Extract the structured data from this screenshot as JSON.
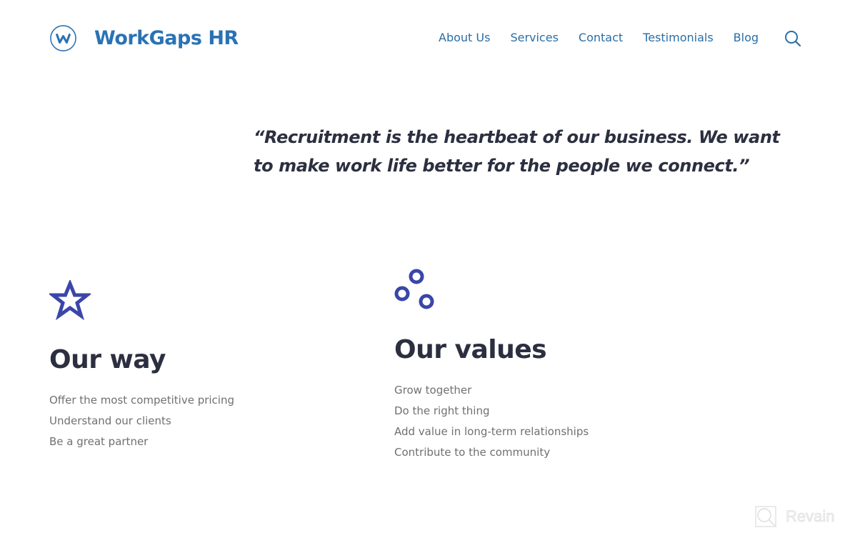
{
  "header": {
    "brand": "WorkGaps HR",
    "logo_icon": "w-circle-logo-icon",
    "nav": [
      {
        "label": "About Us"
      },
      {
        "label": "Services"
      },
      {
        "label": "Contact"
      },
      {
        "label": "Testimonials"
      },
      {
        "label": "Blog"
      }
    ],
    "search_icon": "search-icon"
  },
  "quote": {
    "text": "“Recruitment is the heartbeat of our business. We want to make work life better for the people we connect.”"
  },
  "features": [
    {
      "icon": "star-outline-icon",
      "title": "Our way",
      "items": [
        "Offer the most competitive pricing",
        "Understand our clients",
        "Be a great partner"
      ]
    },
    {
      "icon": "three-circles-icon",
      "title": "Our values",
      "items": [
        "Grow together",
        "Do the right thing",
        "Add value in long-term relationships",
        "Contribute to the community"
      ]
    }
  ],
  "watermark": {
    "text": "Revain"
  },
  "colors": {
    "brand_blue": "#2a72b5",
    "nav_blue": "#2a6ea6",
    "icon_indigo": "#3a46a8",
    "heading_dark": "#2b2f3f",
    "body_gray": "#707070"
  }
}
